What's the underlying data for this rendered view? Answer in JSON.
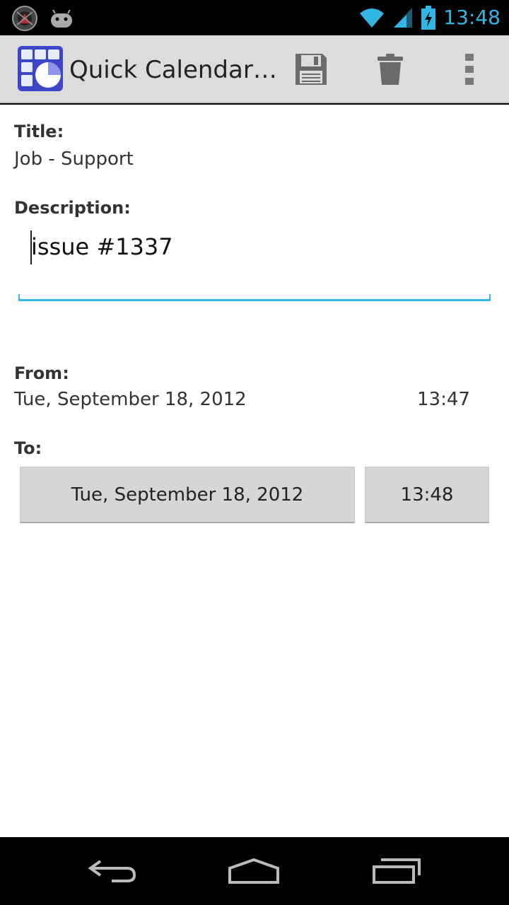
{
  "status_bar": {
    "time": "13:48",
    "icons": [
      "avatar-notification-icon",
      "android-notification-icon",
      "wifi-icon",
      "signal-icon",
      "battery-charging-icon"
    ]
  },
  "action_bar": {
    "title": "Quick Calendar…",
    "actions": [
      "save-icon",
      "delete-icon",
      "overflow-menu-icon"
    ]
  },
  "form": {
    "title_label": "Title:",
    "title_value": "Job - Support",
    "description_label": "Description:",
    "description_value": "issue #1337",
    "from_label": "From:",
    "from_date": "Tue, September 18, 2012",
    "from_time": "13:47",
    "to_label": "To:",
    "to_date": "Tue, September 18, 2012",
    "to_time": "13:48"
  },
  "nav_bar": {
    "buttons": [
      "back-icon",
      "home-icon",
      "recents-icon"
    ]
  },
  "colors": {
    "accent": "#33b5e5",
    "action_bar_bg": "#dcdcdc",
    "button_bg": "#d6d6d6"
  }
}
